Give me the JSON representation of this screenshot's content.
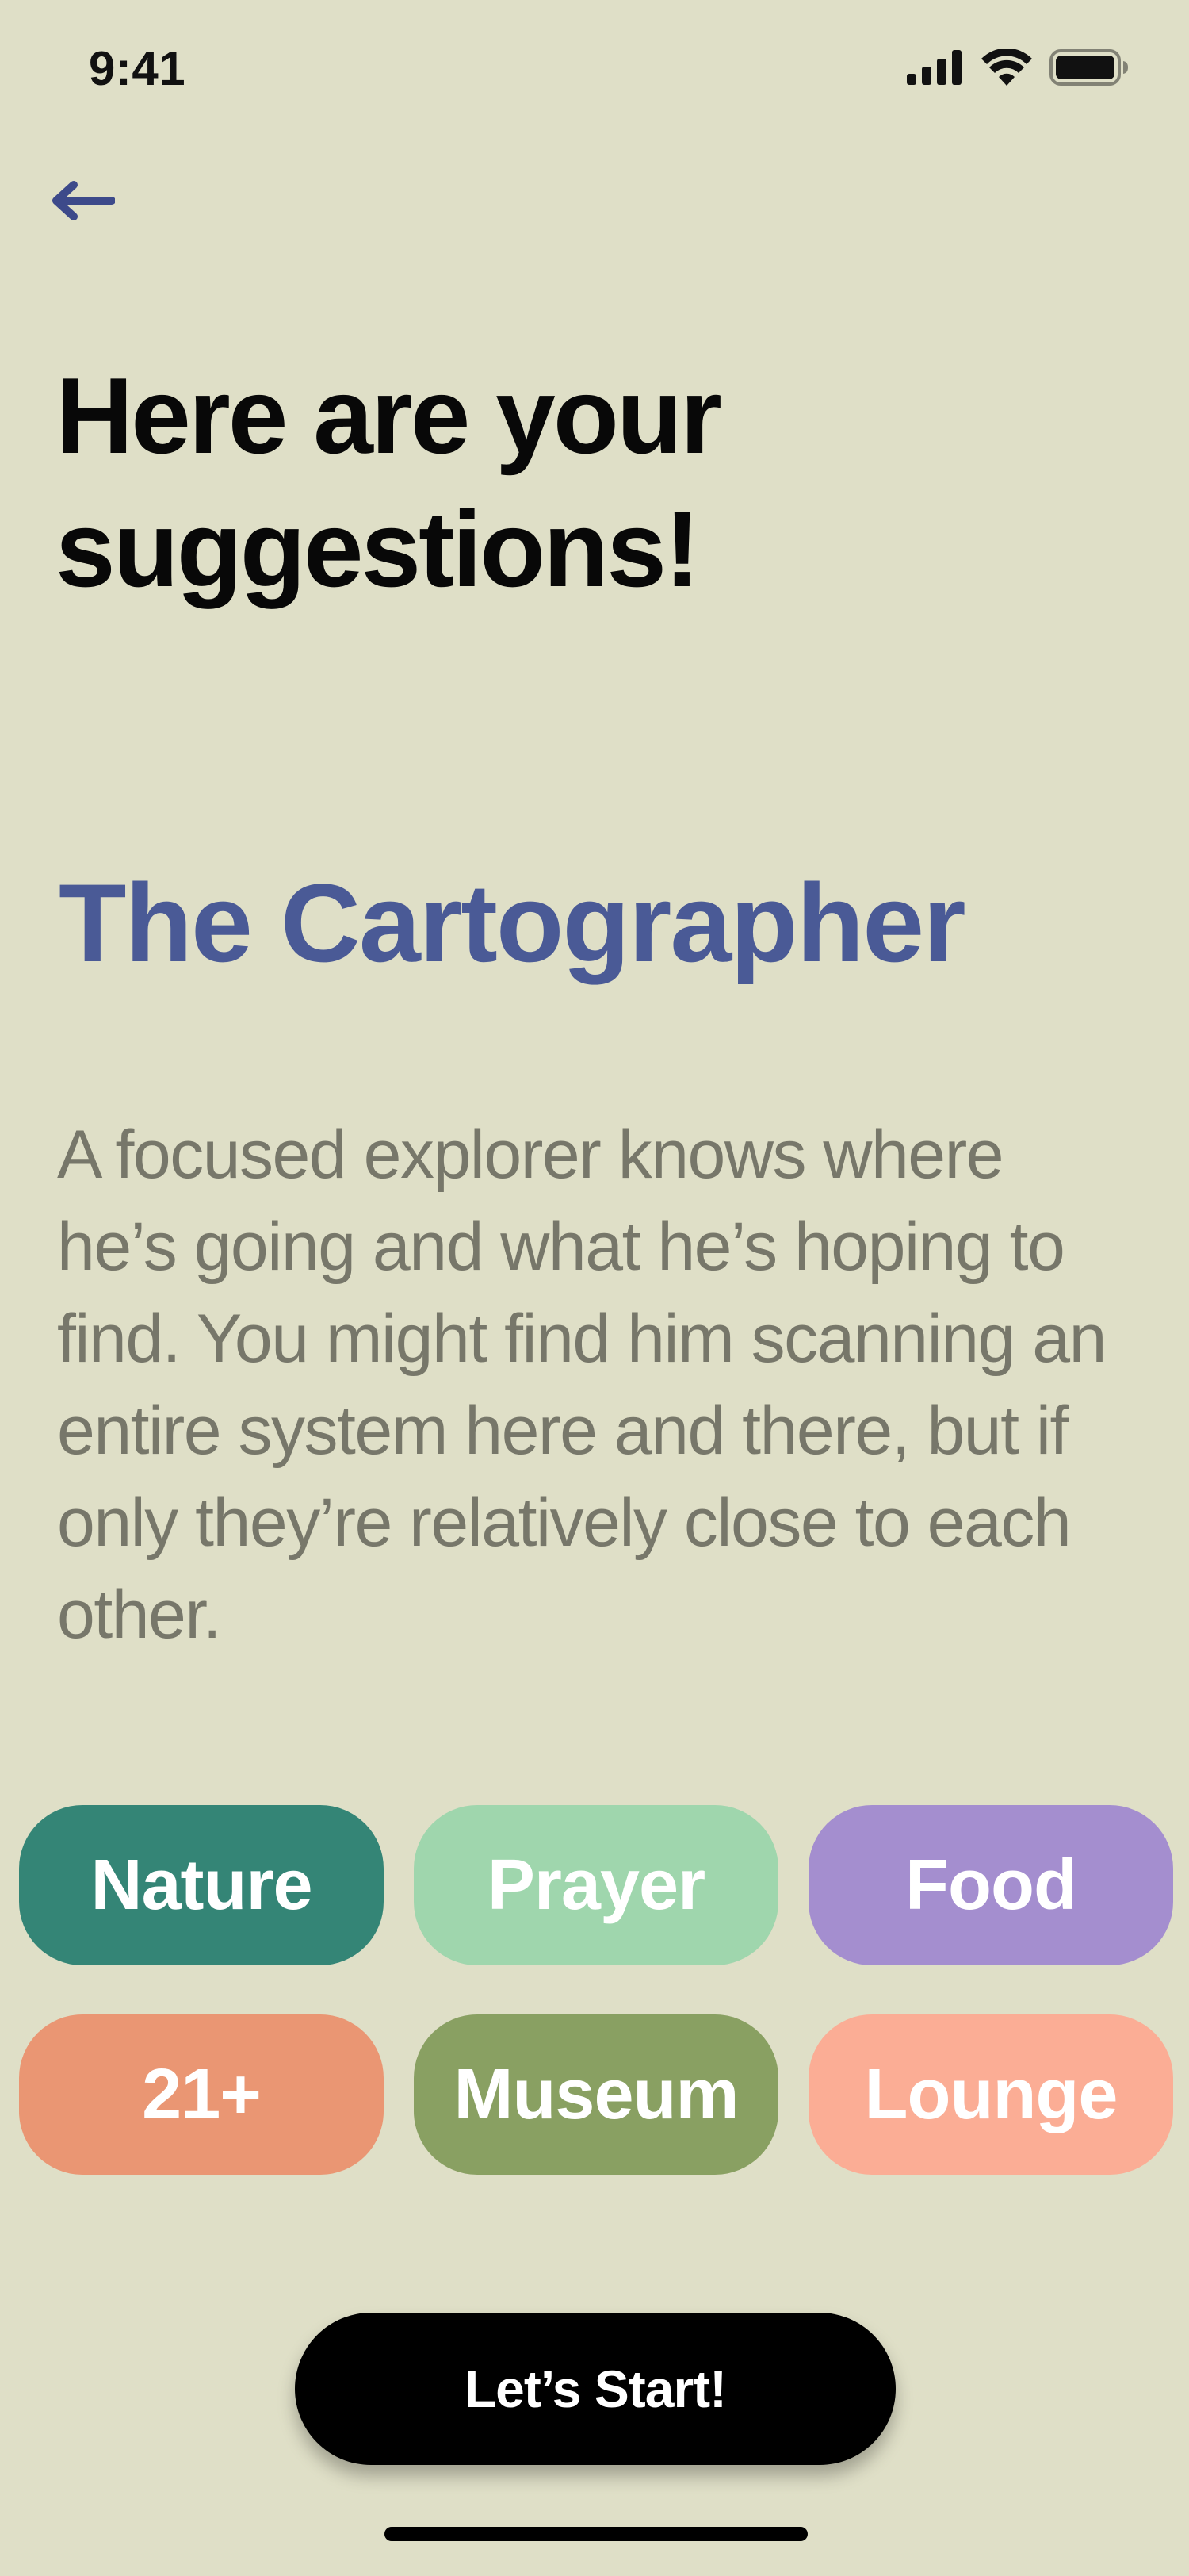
{
  "status_bar": {
    "time": "9:41"
  },
  "header": {
    "back_icon": "arrow-left-icon",
    "title": "Here are your suggestions!"
  },
  "persona": {
    "name": "The Cartographer",
    "description": "A focused explorer knows where he’s going and what he’s hoping to find. You might find him scanning an entire system here and there, but if only they’re relatively close to each other."
  },
  "tags": [
    {
      "label": "Nature",
      "color": "#348576"
    },
    {
      "label": "Prayer",
      "color": "#9fd6ad"
    },
    {
      "label": "Food",
      "color": "#a48ecf"
    },
    {
      "label": "21+",
      "color": "#ea9673"
    },
    {
      "label": "Museum",
      "color": "#89a062"
    },
    {
      "label": "Lounge",
      "color": "#fbad95"
    }
  ],
  "actions": {
    "start_label": "Let’s Start!"
  },
  "colors": {
    "background": "#dfdfc7",
    "accent": "#4a5a96",
    "body_text": "#77776a"
  }
}
